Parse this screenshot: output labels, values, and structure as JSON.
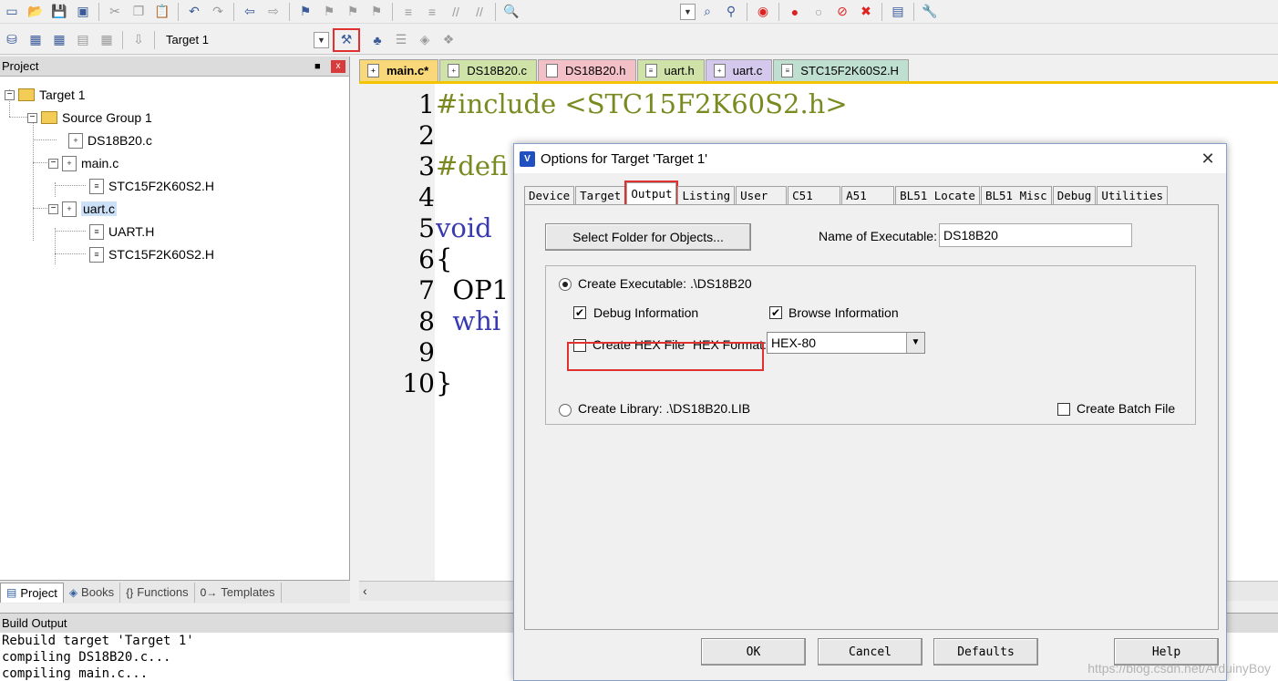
{
  "toolbar": {
    "target_name": "Target 1"
  },
  "project_panel": {
    "title": "Project",
    "pin_glyph": "■",
    "close_glyph": "x",
    "tree": [
      {
        "label": "Target 1"
      },
      {
        "label": "Source Group 1"
      },
      {
        "label": "DS18B20.c"
      },
      {
        "label": "main.c"
      },
      {
        "label": "STC15F2K60S2.H"
      },
      {
        "label": "uart.c"
      },
      {
        "label": "UART.H"
      },
      {
        "label": "STC15F2K60S2.H"
      }
    ],
    "bottom_tabs": [
      {
        "label": "Project"
      },
      {
        "label": "Books"
      },
      {
        "label": "Functions"
      },
      {
        "label": "Templates"
      }
    ]
  },
  "editor": {
    "tabs": [
      {
        "label": "main.c*",
        "color": "#f8d878"
      },
      {
        "label": "DS18B20.c",
        "color": "#cfe3a8"
      },
      {
        "label": "DS18B20.h",
        "color": "#f4c0c8"
      },
      {
        "label": "uart.h",
        "color": "#cfe3a8"
      },
      {
        "label": "uart.c",
        "color": "#d4c8ec"
      },
      {
        "label": "STC15F2K60S2.H",
        "color": "#bfe0d0"
      }
    ],
    "line_numbers": [
      "1",
      "2",
      "3",
      "4",
      "5",
      "6",
      "7",
      "8",
      "9",
      "10"
    ],
    "lines": {
      "l1": "#include <STC15F2K60S2.h>",
      "l3": "#defi",
      "l5": "void",
      "l6": "{",
      "l7": "  OP1",
      "l8": "  whi",
      "l10": "}"
    }
  },
  "build_output": {
    "title": "Build Output",
    "lines": [
      "Rebuild target 'Target 1'",
      "compiling DS18B20.c...",
      "compiling main.c..."
    ]
  },
  "dialog": {
    "title": "Options for Target 'Target 1'",
    "close_glyph": "✕",
    "tabs": [
      "Device",
      "Target",
      "Output",
      "Listing",
      "User",
      "C51",
      "A51",
      "BL51 Locate",
      "BL51 Misc",
      "Debug",
      "Utilities"
    ],
    "select_folder_label": "Select Folder for Objects...",
    "name_exe_label": "Name of Executable:",
    "name_exe_value": "DS18B20",
    "create_exe_label": "Create Executable:  .\\DS18B20",
    "debug_info_label": "Debug Information",
    "browse_info_label": "Browse Information",
    "create_hex_label": "Create HEX File",
    "hex_format_label": "HEX Format:",
    "hex_format_value": "HEX-80",
    "create_lib_label": "Create Library:  .\\DS18B20.LIB",
    "create_batch_label": "Create Batch File",
    "check_glyph": "✔",
    "buttons": {
      "ok": "OK",
      "cancel": "Cancel",
      "defaults": "Defaults",
      "help": "Help"
    }
  },
  "watermark": "https://blog.csdn.net/ArduinyBoy"
}
